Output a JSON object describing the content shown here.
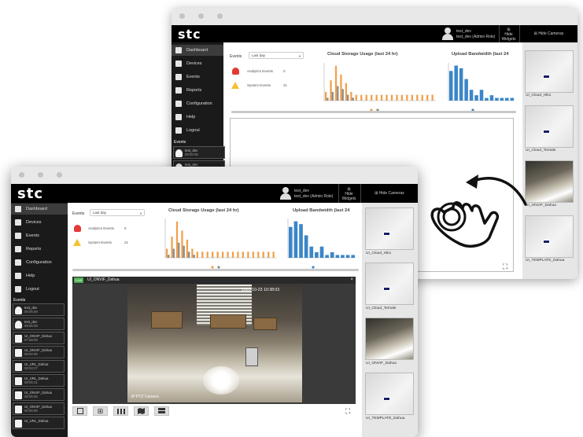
{
  "brand": {
    "logo": "stc"
  },
  "user": {
    "name": "test_dev",
    "role": "test_dev (Admin Role)"
  },
  "topbar": {
    "hide_widgets": "Hide Widgets",
    "hide_cameras": "Hide Cameras"
  },
  "nav": {
    "items": [
      {
        "label": "Dashboard",
        "icon": "dashboard-icon",
        "active": true
      },
      {
        "label": "Devices",
        "icon": "monitor-icon"
      },
      {
        "label": "Events",
        "icon": "calendar-icon"
      },
      {
        "label": "Reports",
        "icon": "bar-chart-icon"
      },
      {
        "label": "Configuration",
        "icon": "gear-icon"
      },
      {
        "label": "Help",
        "icon": "question-icon"
      },
      {
        "label": "Logout",
        "icon": "logout-icon"
      }
    ],
    "events_header": "Events"
  },
  "events_list": [
    {
      "label": "test_dev",
      "time": "08:06:08"
    },
    {
      "label": "test_dev",
      "time": "08:06:08"
    },
    {
      "label": "UI_ONVIF_Dahua",
      "time": "07:58:09"
    },
    {
      "label": "UI_ONVIF_Dahua",
      "time": "08:00:09"
    },
    {
      "label": "UI_URL_Dahua",
      "time": "08:03:27"
    },
    {
      "label": "UI_URL_Dahua",
      "time": "08:05:31"
    },
    {
      "label": "UI_ONVIF_Dahua",
      "time": "08:06:06"
    },
    {
      "label": "UI_ONVIF_Dahua",
      "time": "08:06:08"
    },
    {
      "label": "UI_URL_Dahua",
      "time": ""
    }
  ],
  "summary": {
    "events_label": "Events",
    "period": "Last day",
    "analytics_label": "Analytics Events",
    "analytics_count": "0",
    "system_label": "System Events",
    "system_count": "21"
  },
  "charts": {
    "storage_title": "Cloud Storage Usage (last 24 hr)",
    "bandwidth_title": "Upload Bandwidth (last 24"
  },
  "video": {
    "live_badge": "Live",
    "camera_name": "UI_ONVIF_Dahua",
    "timestamp": "2020-10-23 10:38:03",
    "overlay_label": "IP PTZ Camera",
    "close": "×"
  },
  "cameras_front": [
    {
      "name": "UI_Cloud_Hik1"
    },
    {
      "name": "UI_Cloud_Ternale"
    },
    {
      "name": "UI_ONVIF_Dahua"
    },
    {
      "name": "UI_TEMPLATE_Dahua"
    }
  ],
  "cameras_back": [
    {
      "name": "UI_Cloud_Hik1"
    },
    {
      "name": "UI_Cloud_Ternale"
    },
    {
      "name": "UI_ONVIF_Dahua"
    },
    {
      "name": "UI_TEMPLATE_Dahua"
    }
  ],
  "chart_data": [
    {
      "type": "bar",
      "title": "Cloud Storage Usage (last 24 hr)",
      "series": [
        {
          "color": "#f0a04b",
          "values": [
            3,
            7,
            12,
            9,
            6,
            3,
            2,
            2,
            2,
            2,
            2,
            2,
            2,
            2,
            2,
            2,
            2,
            2,
            2,
            2,
            2,
            2
          ]
        },
        {
          "color": "#8a8a8a",
          "values": [
            1,
            3,
            5,
            4,
            2,
            1,
            0,
            0,
            0,
            0,
            0,
            0,
            0,
            0,
            0,
            0,
            0,
            0,
            0,
            0,
            0,
            0
          ]
        }
      ],
      "ylim": [
        0,
        13
      ]
    },
    {
      "type": "bar",
      "title": "Upload Bandwidth (last 24",
      "series": [
        {
          "color": "#3a86c8",
          "values": [
            11,
            13,
            12,
            8,
            4,
            2,
            4,
            1,
            2,
            1,
            1,
            1,
            1
          ]
        }
      ],
      "ylim": [
        0,
        14
      ]
    }
  ],
  "colors": {
    "accent_green": "#4caf50",
    "alert_red": "#e53935",
    "warning_yellow": "#f3c030",
    "chart_orange": "#f0a04b",
    "chart_blue": "#3a86c8"
  }
}
